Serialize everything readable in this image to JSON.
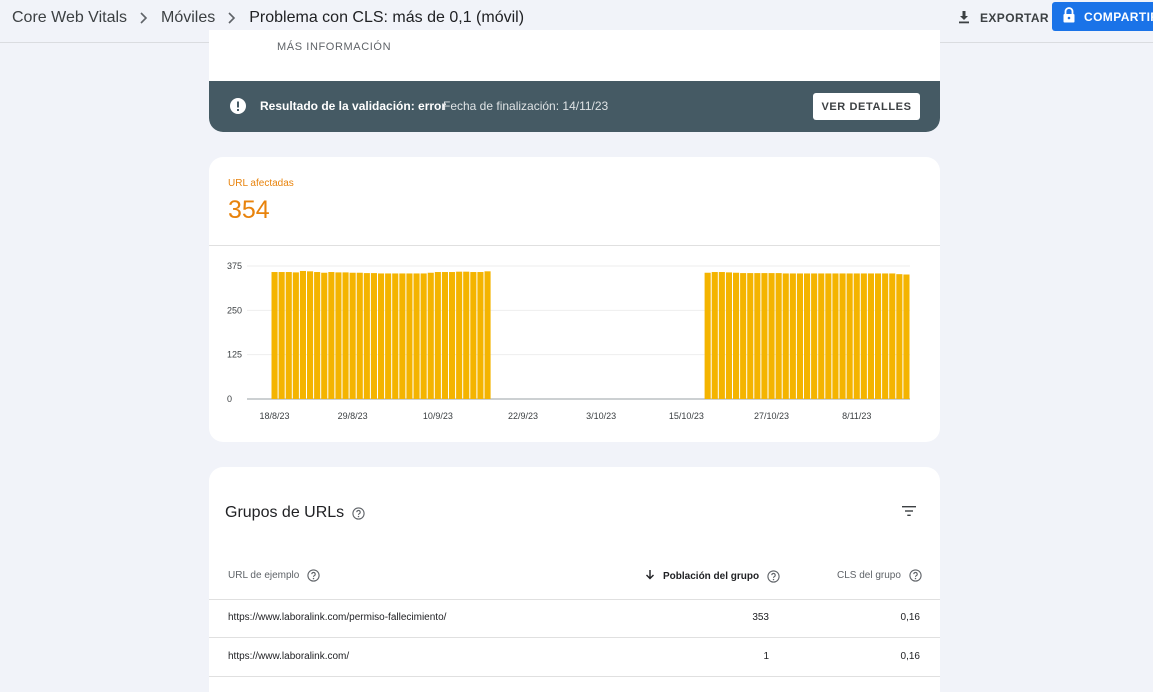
{
  "header": {
    "breadcrumbs": [
      "Core Web Vitals",
      "Móviles",
      "Problema con CLS: más de 0,1 (móvil)"
    ],
    "export_label": "EXPORTAR",
    "share_label": "COMPARTIR"
  },
  "info": {
    "more_info": "MÁS INFORMACIÓN",
    "validation_result": "Resultado de la validación: error",
    "validation_date": "Fecha de finalización: 14/11/23",
    "details_button": "VER DETALLES"
  },
  "affected": {
    "label": "URL afectadas",
    "value": "354"
  },
  "chart_data": {
    "type": "bar",
    "title": "",
    "xlabel": "",
    "ylabel": "",
    "ylim": [
      0,
      375
    ],
    "yticks": [
      "375",
      "250",
      "125",
      "0"
    ],
    "xticks": [
      "18/8/23",
      "29/8/23",
      "10/9/23",
      "22/9/23",
      "3/10/23",
      "15/10/23",
      "27/10/23",
      "8/11/23"
    ],
    "categories": [
      "18/8/23",
      "19/8/23",
      "20/8/23",
      "21/8/23",
      "22/8/23",
      "23/8/23",
      "24/8/23",
      "25/8/23",
      "26/8/23",
      "27/8/23",
      "28/8/23",
      "29/8/23",
      "30/8/23",
      "31/8/23",
      "1/9/23",
      "2/9/23",
      "3/9/23",
      "4/9/23",
      "5/9/23",
      "6/9/23",
      "7/9/23",
      "8/9/23",
      "9/9/23",
      "10/9/23",
      "11/9/23",
      "12/9/23",
      "13/9/23",
      "14/9/23",
      "15/9/23",
      "16/9/23",
      "17/9/23",
      "18/9/23",
      "19/9/23",
      "20/9/23",
      "21/9/23",
      "22/9/23",
      "23/9/23",
      "24/9/23",
      "25/9/23",
      "26/9/23",
      "27/9/23",
      "28/9/23",
      "29/9/23",
      "30/9/23",
      "1/10/23",
      "2/10/23",
      "3/10/23",
      "4/10/23",
      "5/10/23",
      "6/10/23",
      "7/10/23",
      "8/10/23",
      "9/10/23",
      "10/10/23",
      "11/10/23",
      "12/10/23",
      "13/10/23",
      "14/10/23",
      "15/10/23",
      "16/10/23",
      "17/10/23",
      "18/10/23",
      "19/10/23",
      "20/10/23",
      "21/10/23",
      "22/10/23",
      "23/10/23",
      "24/10/23",
      "25/10/23",
      "26/10/23",
      "27/10/23",
      "28/10/23",
      "29/10/23",
      "30/10/23",
      "31/10/23",
      "1/11/23",
      "2/11/23",
      "3/11/23",
      "4/11/23",
      "5/11/23",
      "6/11/23",
      "7/11/23",
      "8/11/23",
      "9/11/23",
      "10/11/23",
      "11/11/23",
      "12/11/23",
      "13/11/23"
    ],
    "values": [
      358,
      358,
      358,
      357,
      361,
      360,
      358,
      356,
      358,
      357,
      357,
      356,
      356,
      355,
      355,
      354,
      354,
      354,
      354,
      354,
      354,
      354,
      356,
      358,
      358,
      358,
      359,
      359,
      358,
      358,
      360,
      null,
      null,
      null,
      null,
      null,
      null,
      null,
      null,
      null,
      null,
      null,
      null,
      null,
      null,
      null,
      null,
      null,
      null,
      null,
      null,
      null,
      null,
      null,
      null,
      null,
      null,
      null,
      null,
      null,
      null,
      356,
      358,
      358,
      357,
      356,
      355,
      355,
      355,
      355,
      355,
      355,
      354,
      354,
      354,
      354,
      354,
      354,
      354,
      354,
      354,
      354,
      354,
      354,
      354,
      354,
      354,
      354,
      352,
      351
    ],
    "bar_color": "#f4b400",
    "grid": true
  },
  "table": {
    "title": "Grupos de URLs",
    "columns": {
      "url": "URL de ejemplo",
      "population": "Población del grupo",
      "cls": "CLS del grupo"
    },
    "rows": [
      {
        "url": "https://www.laboralink.com/permiso-fallecimiento/",
        "population": "353",
        "cls": "0,16"
      },
      {
        "url": "https://www.laboralink.com/",
        "population": "1",
        "cls": "0,16"
      }
    ]
  }
}
